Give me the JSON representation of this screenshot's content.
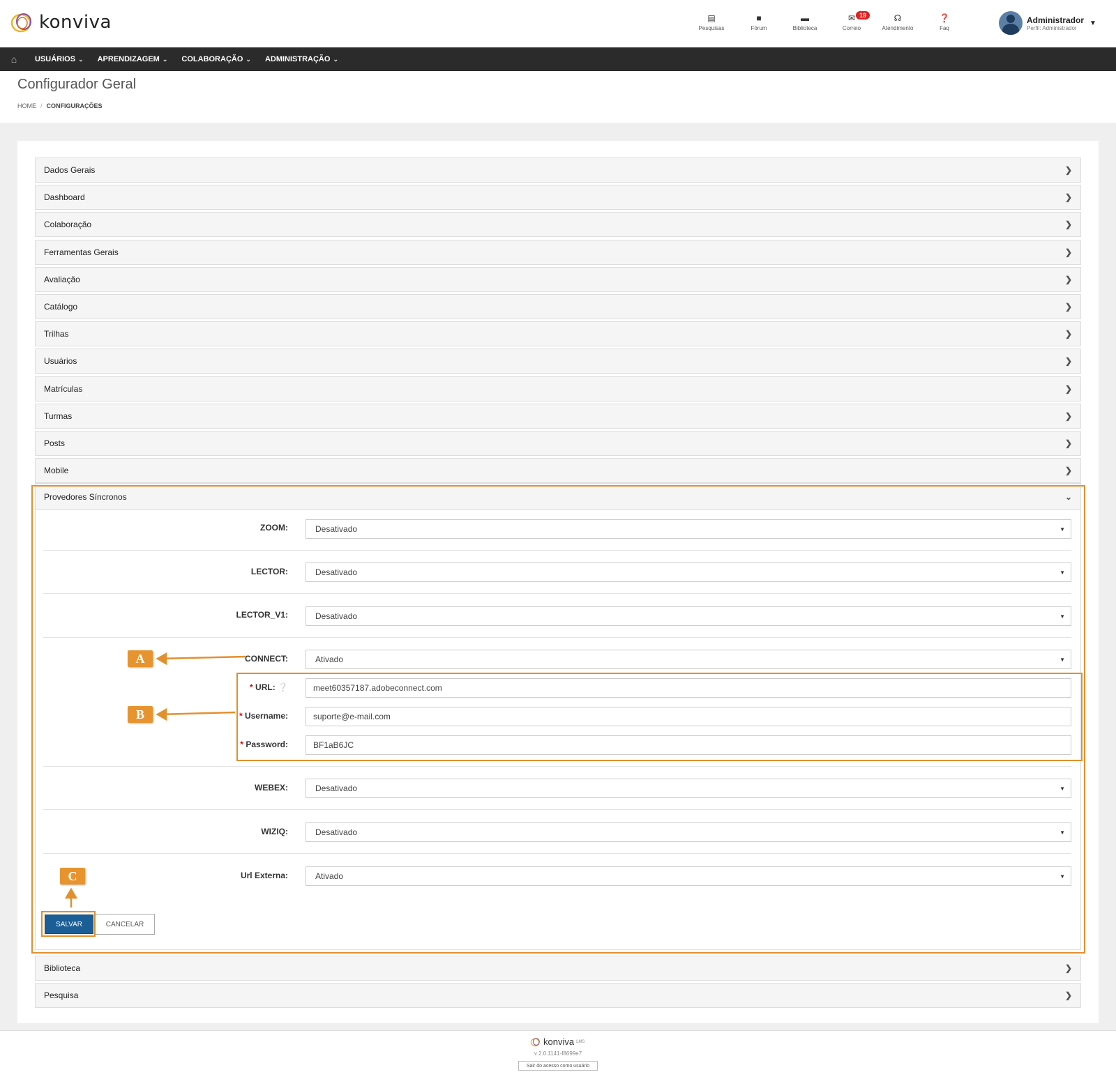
{
  "header": {
    "logo_text": "konviva",
    "nav": [
      {
        "label": "Pesquisas",
        "icon": "search-doc-icon"
      },
      {
        "label": "Fórum",
        "icon": "chat-icon"
      },
      {
        "label": "Biblioteca",
        "icon": "folder-icon"
      },
      {
        "label": "Correio",
        "icon": "envelope-icon",
        "badge": "19"
      },
      {
        "label": "Atendimento",
        "icon": "headset-icon"
      },
      {
        "label": "Faq",
        "icon": "question-icon"
      }
    ],
    "user": {
      "name": "Administrador",
      "role": "Perfil: Administrador"
    }
  },
  "menu": {
    "items": [
      "USUÁRIOS",
      "APRENDIZAGEM",
      "COLABORAÇÃO",
      "ADMINISTRAÇÃO"
    ]
  },
  "page": {
    "title": "Configurador Geral",
    "breadcrumb": {
      "home": "HOME",
      "separator": "/",
      "current": "CONFIGURAÇÕES"
    }
  },
  "sections": [
    "Dados Gerais",
    "Dashboard",
    "Colaboração",
    "Ferramentas Gerais",
    "Avaliação",
    "Catálogo",
    "Trilhas",
    "Usuários",
    "Matrículas",
    "Turmas",
    "Posts",
    "Mobile"
  ],
  "providers": {
    "title": "Provedores Síncronos",
    "fields": {
      "zoom": {
        "label": "ZOOM:",
        "value": "Desativado"
      },
      "lector": {
        "label": "LECTOR:",
        "value": "Desativado"
      },
      "lector_v1": {
        "label": "LECTOR_V1:",
        "value": "Desativado"
      },
      "connect": {
        "label": "CONNECT:",
        "value": "Ativado"
      },
      "url": {
        "label": "URL:",
        "value": "meet60357187.adobeconnect.com"
      },
      "username": {
        "label": "Username:",
        "value": "suporte@e-mail.com"
      },
      "password": {
        "label": "Password:",
        "value": "BF1aB6JC"
      },
      "webex": {
        "label": "WEBEX:",
        "value": "Desativado"
      },
      "wiziq": {
        "label": "WIZIQ:",
        "value": "Desativado"
      },
      "url_externa": {
        "label": "Url Externa:",
        "value": "Ativado"
      }
    },
    "required_mark": "*",
    "save_label": "SALVAR",
    "cancel_label": "CANCELAR"
  },
  "sections_after": [
    "Biblioteca",
    "Pesquisa"
  ],
  "annotations": {
    "a": "A",
    "b": "B",
    "c": "C",
    "color": "#e2902e"
  },
  "footer": {
    "logo_text": "konviva",
    "lms": "LMS",
    "version": "v 2.0.1141-f8699e7",
    "exit_label": "Sair do acesso como usuário"
  }
}
